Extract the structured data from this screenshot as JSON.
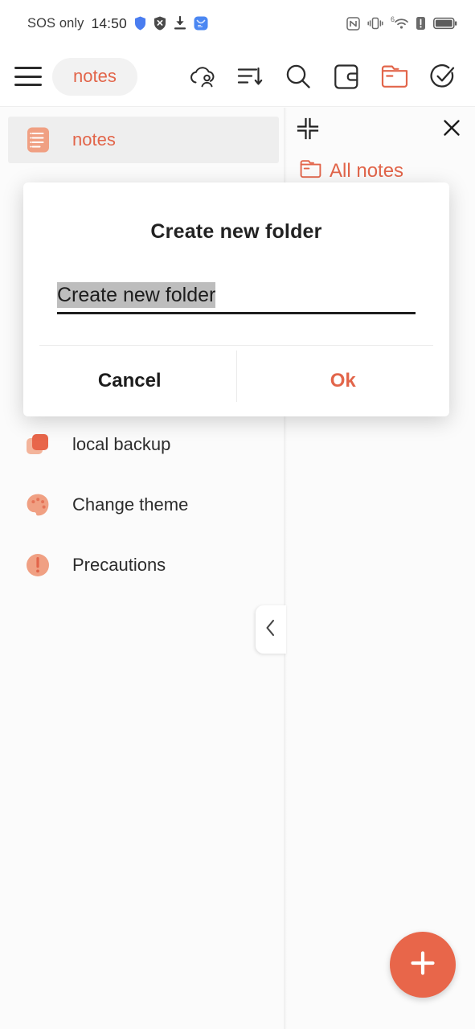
{
  "status_bar": {
    "carrier": "SOS only",
    "time": "14:50",
    "left_icons": [
      "shield-blue-icon",
      "shield-block-icon",
      "download-icon",
      "app-blue-icon"
    ],
    "right_icons": [
      "nfc-icon",
      "vibrate-icon",
      "wifi-6-icon",
      "alert-icon",
      "battery-icon"
    ],
    "wifi_superscript": "6"
  },
  "toolbar": {
    "menu_icon": "hamburger-menu-icon",
    "app_title": "notes",
    "actions": [
      {
        "name": "cloud-account-icon",
        "color": "#2b2b2b"
      },
      {
        "name": "sort-icon",
        "color": "#2b2b2b"
      },
      {
        "name": "search-icon",
        "color": "#2b2b2b"
      },
      {
        "name": "note-card-icon",
        "color": "#2b2b2b"
      },
      {
        "name": "folder-icon",
        "color": "#e2654a"
      },
      {
        "name": "check-circle-icon",
        "color": "#2b2b2b"
      }
    ]
  },
  "sidebar": {
    "items": [
      {
        "label": "notes",
        "icon": "notes-list-icon",
        "selected": true
      },
      {
        "label": "local backup",
        "icon": "backup-icon",
        "selected": false
      },
      {
        "label": "Change theme",
        "icon": "palette-icon",
        "selected": false
      },
      {
        "label": "Precautions",
        "icon": "alert-circle-icon",
        "selected": false
      }
    ],
    "collapse_handle_icon": "chevron-left-icon"
  },
  "right_panel": {
    "minimize_icon": "collapse-corners-icon",
    "close_icon": "close-icon",
    "all_notes_label": "All notes",
    "all_notes_icon": "folder-icon",
    "fab_icon": "plus-icon"
  },
  "dialog": {
    "title": "Create new folder",
    "input_value": "Create new folder",
    "input_placeholder": "Create new folder",
    "cancel_label": "Cancel",
    "ok_label": "Ok"
  },
  "colors": {
    "accent": "#e2654a",
    "fab": "#e8664a",
    "icon_tint": "#f0a083",
    "text": "#2c2c2c",
    "selected_row": "#eeeeee",
    "page_bg": "#fbfbfb"
  }
}
